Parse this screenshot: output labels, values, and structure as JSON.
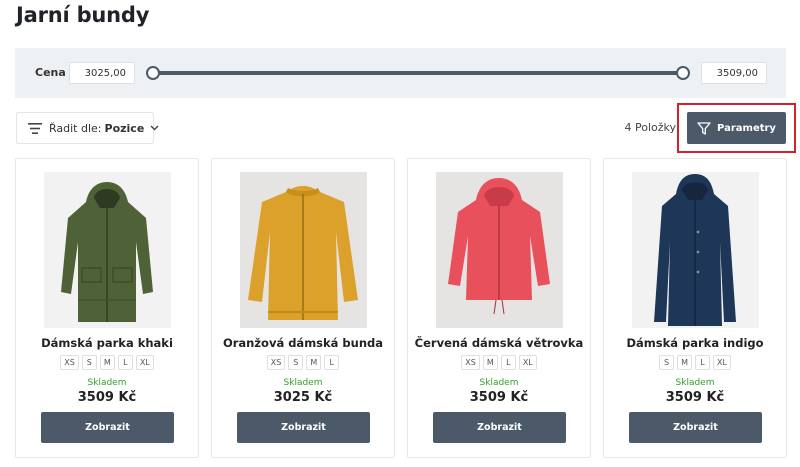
{
  "page": {
    "title": "Jarní bundy"
  },
  "price_filter": {
    "label": "Cena",
    "min_value": "3025,00",
    "max_value": "3509,00"
  },
  "toolbar": {
    "sort_label": "Řadit dle:",
    "sort_value": "Pozice",
    "item_count": "4 Položky",
    "params_label": "Parametry"
  },
  "products": [
    {
      "name": "Dámská parka khaki",
      "sizes": [
        "XS",
        "S",
        "M",
        "L",
        "XL"
      ],
      "stock": "Skladem",
      "price": "3509 Kč",
      "button": "Zobrazit",
      "color": "#4f6137"
    },
    {
      "name": "Oranžová dámská bunda",
      "sizes": [
        "XS",
        "S",
        "M",
        "L"
      ],
      "stock": "Skladem",
      "price": "3025 Kč",
      "button": "Zobrazit",
      "color": "#dca12a"
    },
    {
      "name": "Červená dámská větrovka",
      "sizes": [
        "XS",
        "M",
        "L",
        "XL"
      ],
      "stock": "Skladem",
      "price": "3509 Kč",
      "button": "Zobrazit",
      "color": "#e8505c"
    },
    {
      "name": "Dámská parka indigo",
      "sizes": [
        "S",
        "M",
        "L",
        "XL"
      ],
      "stock": "Skladem",
      "price": "3509 Kč",
      "button": "Zobrazit",
      "color": "#1e3657"
    }
  ],
  "colors": {
    "accent": "#4b5968",
    "stock": "#2ba42b",
    "highlight": "#d2222d"
  }
}
